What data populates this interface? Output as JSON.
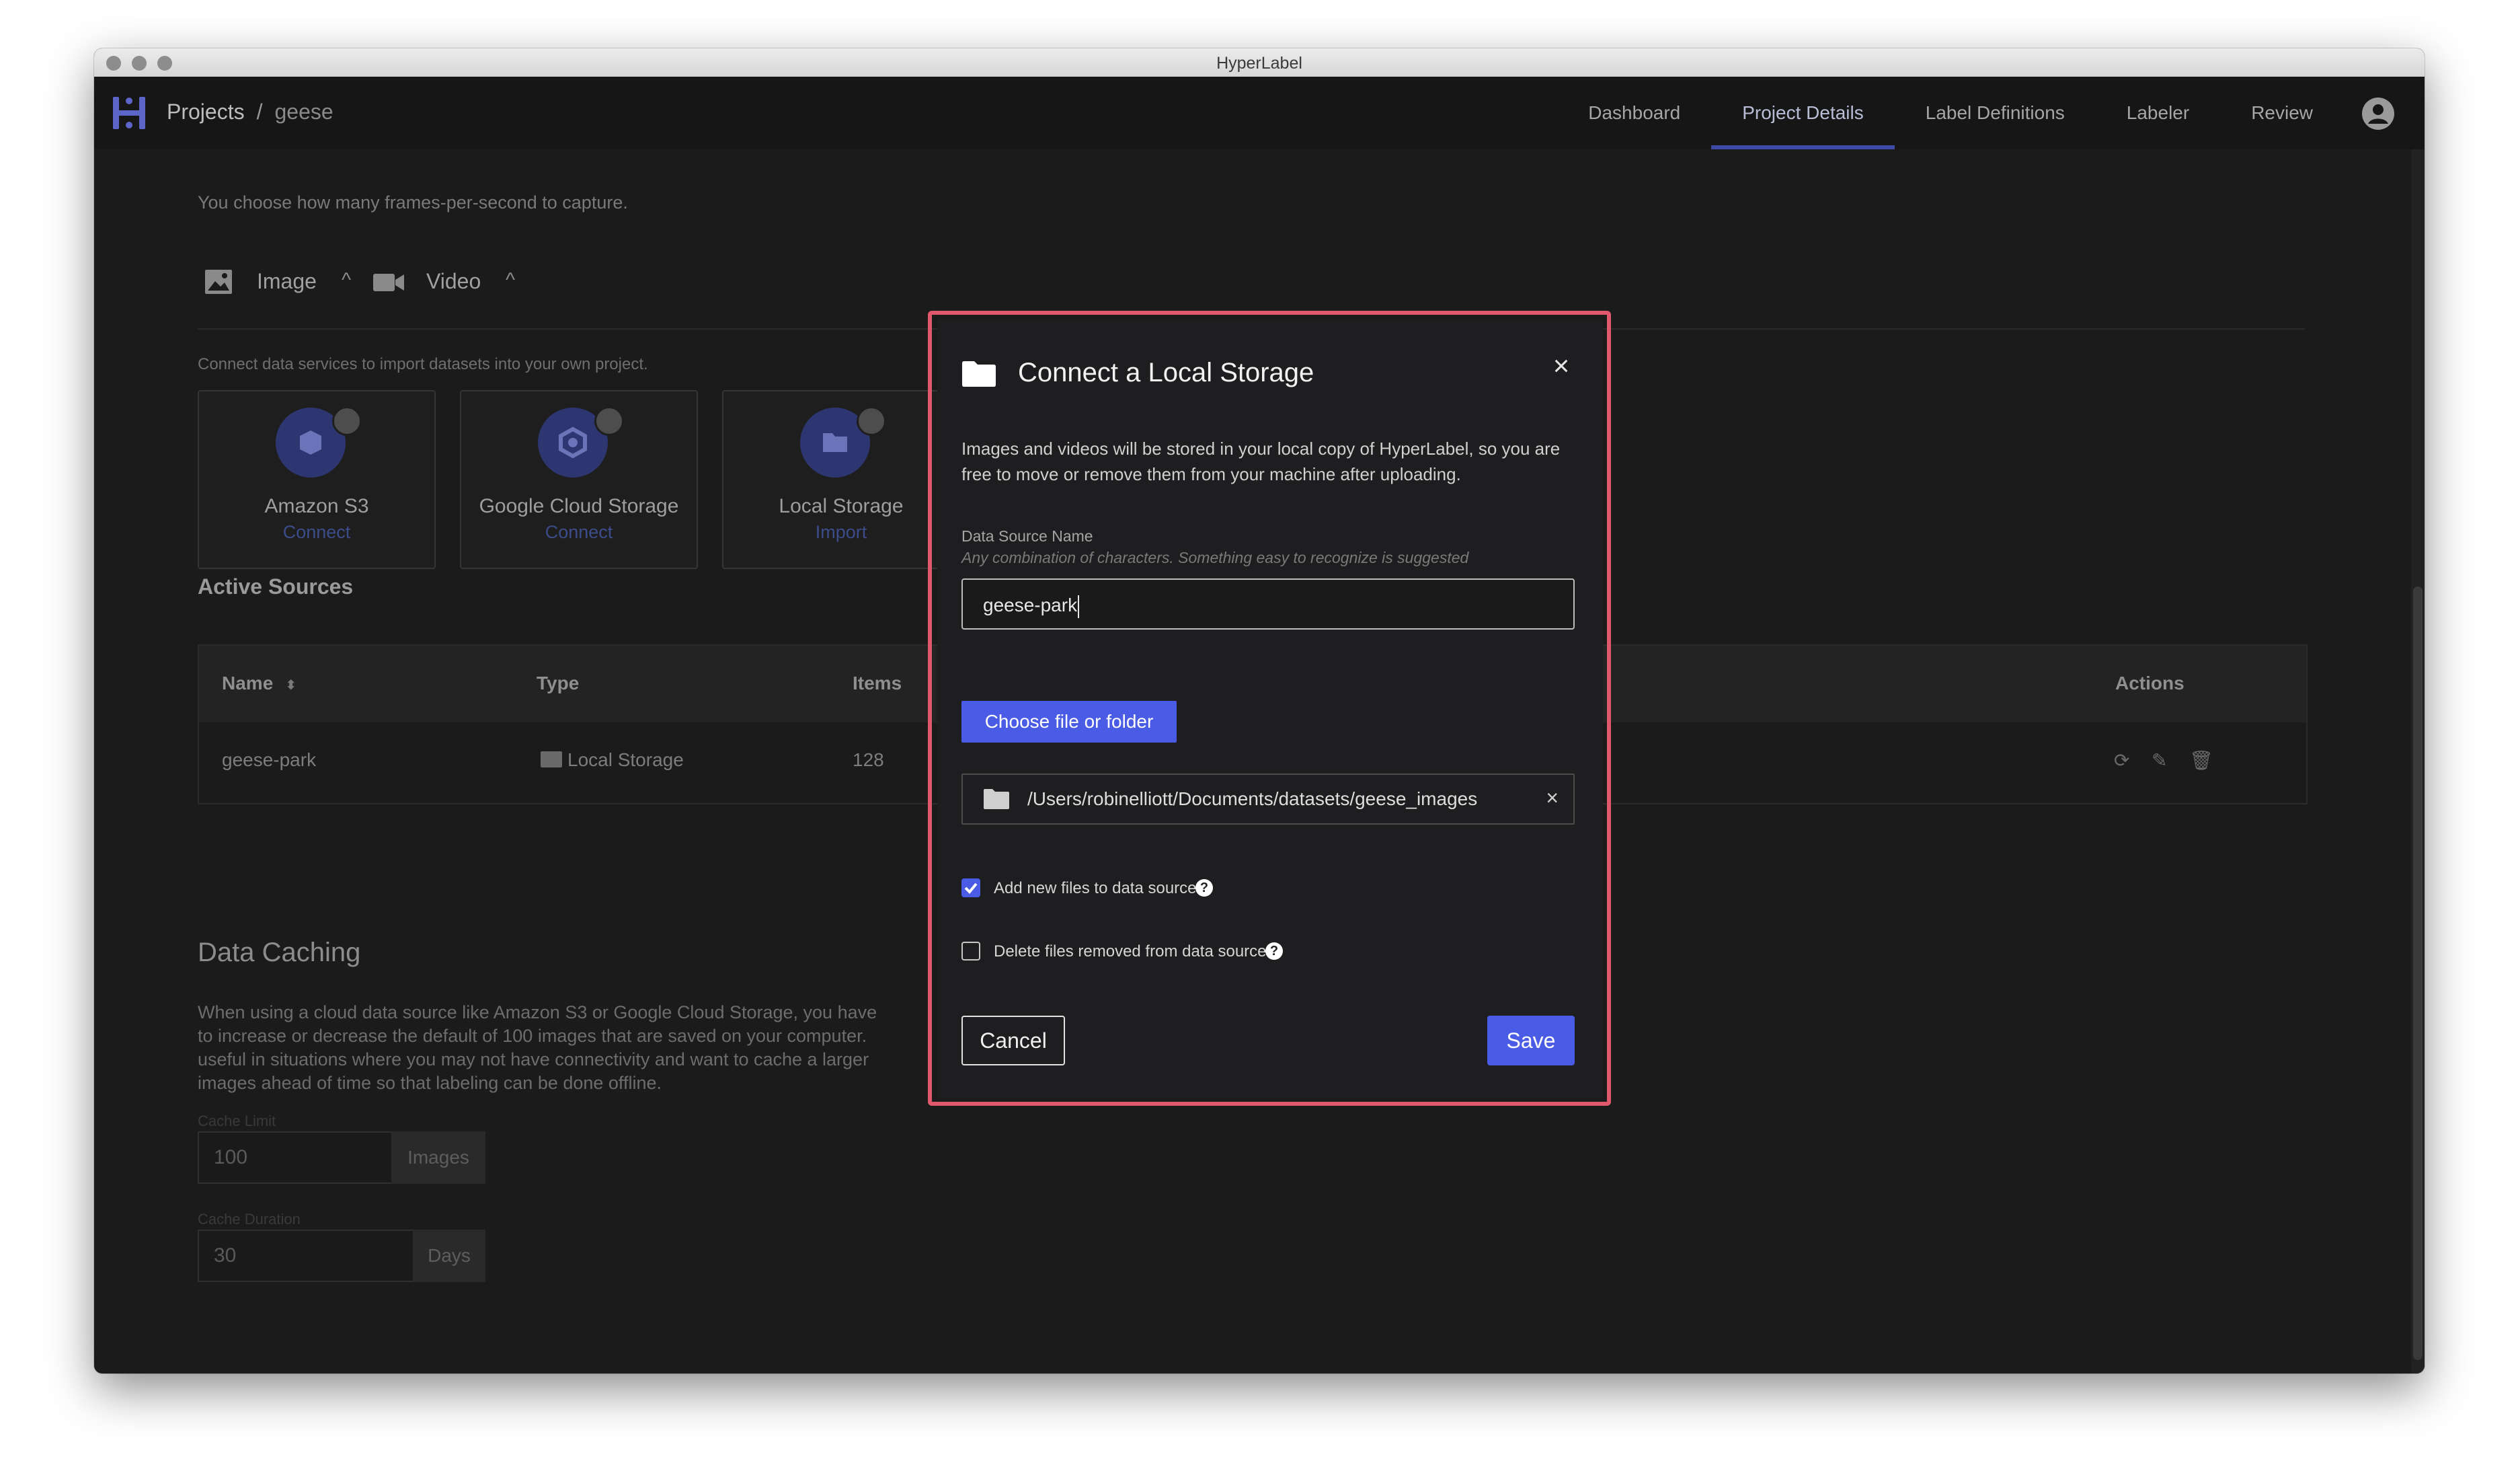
{
  "window": {
    "title": "HyperLabel"
  },
  "navbar": {
    "breadcrumb_root": "Projects",
    "breadcrumb_sep": "/",
    "breadcrumb_current": "geese",
    "tabs": [
      {
        "label": "Dashboard"
      },
      {
        "label": "Project Details"
      },
      {
        "label": "Label Definitions"
      },
      {
        "label": "Labeler"
      },
      {
        "label": "Review"
      }
    ]
  },
  "background": {
    "top_text": "You choose how many frames-per-second to capture.",
    "media_types": [
      {
        "label": "Image"
      },
      {
        "label": "Video"
      }
    ],
    "connect_text": "Connect data services to import datasets into your own project.",
    "sources": [
      {
        "title": "Amazon S3",
        "action": "Connect"
      },
      {
        "title": "Google Cloud Storage",
        "action": "Connect"
      },
      {
        "title": "Local Storage",
        "action": "Import"
      }
    ],
    "active_sources_title": "Active Sources",
    "table": {
      "headers": {
        "name": "Name",
        "type": "Type",
        "items": "Items",
        "actions": "Actions"
      },
      "rows": [
        {
          "name": "geese-park",
          "type": "Local Storage",
          "items": "128"
        }
      ]
    },
    "caching": {
      "title": "Data Caching",
      "lines": [
        "When using a cloud data source like Amazon S3 or Google Cloud Storage, you have",
        "to increase or decrease the default of 100 images that are saved on your computer.",
        "useful in situations where you may not have connectivity and want to cache a larger",
        "images ahead of time so that labeling can be done offline."
      ],
      "limit_label": "Cache Limit",
      "limit_value": "100",
      "limit_unit": "Images",
      "duration_label": "Cache Duration",
      "duration_value": "30",
      "duration_unit": "Days"
    }
  },
  "modal": {
    "title": "Connect a Local Storage",
    "close": "×",
    "description": "Images and videos will be stored in your local copy of HyperLabel, so you are free to move or remove them from your machine after uploading.",
    "name_label": "Data Source Name",
    "name_hint": "Any combination of characters. Something easy to recognize is suggested",
    "name_value": "geese-park",
    "choose_label": "Choose file or folder",
    "path": "/Users/robinelliott/Documents/datasets/geese_images",
    "path_remove": "×",
    "option_add": {
      "label": "Add new files to data source",
      "checked": true
    },
    "option_delete": {
      "label": "Delete files removed from data source",
      "checked": false
    },
    "help_glyph": "?",
    "cancel_label": "Cancel",
    "save_label": "Save"
  },
  "colors": {
    "accent": "#4a5ce6",
    "highlight": "#e0586b",
    "background": "#1b1b1c"
  }
}
